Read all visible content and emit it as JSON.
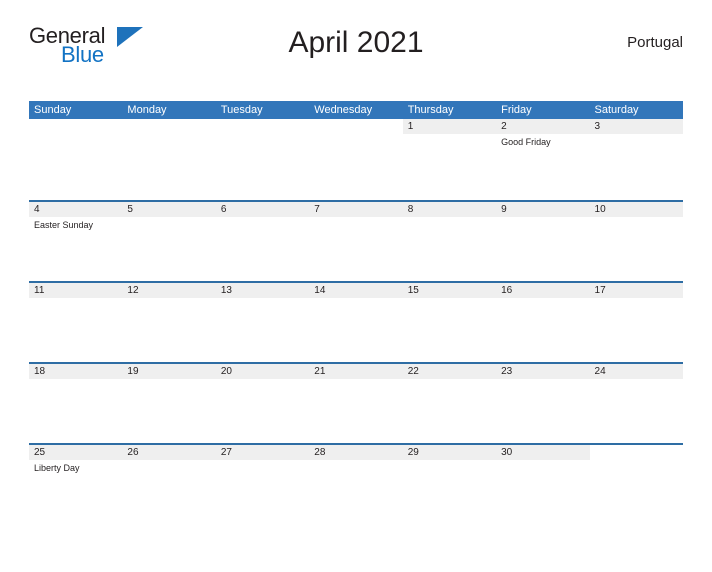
{
  "brand": {
    "name_part1": "General",
    "name_part2": "Blue",
    "flag_icon": "blue-flag-triangle",
    "accent_color": "#1273c4"
  },
  "header": {
    "title": "April 2021",
    "country": "Portugal"
  },
  "colors": {
    "header_blue": "#3276ba",
    "row_rule_blue": "#2e6da4",
    "date_band_gray": "#efefef",
    "text": "#231f20"
  },
  "calendar": {
    "month": "April",
    "year": "2021",
    "weekday_headers": [
      "Sunday",
      "Monday",
      "Tuesday",
      "Wednesday",
      "Thursday",
      "Friday",
      "Saturday"
    ],
    "weeks": [
      [
        {
          "day": "",
          "event": ""
        },
        {
          "day": "",
          "event": ""
        },
        {
          "day": "",
          "event": ""
        },
        {
          "day": "",
          "event": ""
        },
        {
          "day": "1",
          "event": ""
        },
        {
          "day": "2",
          "event": "Good Friday"
        },
        {
          "day": "3",
          "event": ""
        }
      ],
      [
        {
          "day": "4",
          "event": "Easter Sunday"
        },
        {
          "day": "5",
          "event": ""
        },
        {
          "day": "6",
          "event": ""
        },
        {
          "day": "7",
          "event": ""
        },
        {
          "day": "8",
          "event": ""
        },
        {
          "day": "9",
          "event": ""
        },
        {
          "day": "10",
          "event": ""
        }
      ],
      [
        {
          "day": "11",
          "event": ""
        },
        {
          "day": "12",
          "event": ""
        },
        {
          "day": "13",
          "event": ""
        },
        {
          "day": "14",
          "event": ""
        },
        {
          "day": "15",
          "event": ""
        },
        {
          "day": "16",
          "event": ""
        },
        {
          "day": "17",
          "event": ""
        }
      ],
      [
        {
          "day": "18",
          "event": ""
        },
        {
          "day": "19",
          "event": ""
        },
        {
          "day": "20",
          "event": ""
        },
        {
          "day": "21",
          "event": ""
        },
        {
          "day": "22",
          "event": ""
        },
        {
          "day": "23",
          "event": ""
        },
        {
          "day": "24",
          "event": ""
        }
      ],
      [
        {
          "day": "25",
          "event": "Liberty Day"
        },
        {
          "day": "26",
          "event": ""
        },
        {
          "day": "27",
          "event": ""
        },
        {
          "day": "28",
          "event": ""
        },
        {
          "day": "29",
          "event": ""
        },
        {
          "day": "30",
          "event": ""
        },
        {
          "day": "",
          "event": ""
        }
      ]
    ]
  }
}
